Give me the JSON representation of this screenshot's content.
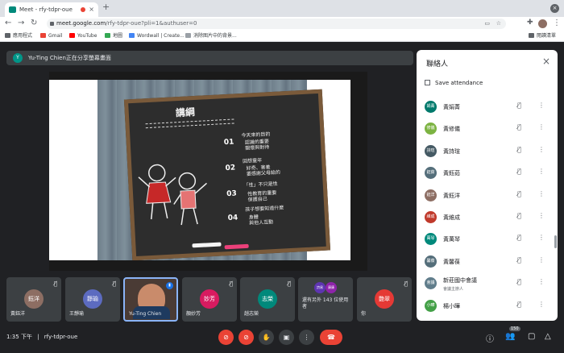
{
  "browser": {
    "tab_title": "Meet - rfy-tdpr-oue",
    "tab_close": "×",
    "new_tab": "+",
    "url_host": "meet.google.com",
    "url_path": "/rfy-tdpr-oue?pli=1&authuser=0",
    "bookmarks": [
      "應用程式",
      "Gmail",
      "YouTube",
      "地圖",
      "Wordwall | Create...",
      "消除图片中的背景..."
    ],
    "reading_list": "閱讀清單"
  },
  "banner": {
    "avatar": "Y",
    "text": "Yu-Ting Chien正在分享螢幕畫面"
  },
  "slide": {
    "title": "講綱",
    "sections": [
      {
        "num": "01",
        "heading": "今天來的目的",
        "bullets": [
          "認識的重要",
          "關懷與對待"
        ]
      },
      {
        "num": "02",
        "heading": "回想童年",
        "bullets": [
          "好奇、害羞",
          "要感謝父母給的"
        ]
      },
      {
        "num": "03",
        "heading": "「性」不只是性",
        "bullets": [
          "性教育的重要",
          "保護自己"
        ]
      },
      {
        "num": "04",
        "heading": "孩子想要知道什麼",
        "bullets": [
          "身體",
          "與他人互動"
        ]
      }
    ]
  },
  "panel": {
    "title": "聯絡人",
    "close": "×",
    "save_attendance": "Save attendance",
    "participants": [
      {
        "avatar": "娟菁",
        "name": "黃娟菁",
        "sub": "",
        "color": "#00796b"
      },
      {
        "avatar": "修儀",
        "name": "黃修儀",
        "sub": "",
        "color": "#7cb342"
      },
      {
        "avatar": "詩瑄",
        "name": "黃詩瑄",
        "sub": "",
        "color": "#455a64"
      },
      {
        "avatar": "鈺茹",
        "name": "黃鈺茹",
        "sub": "",
        "color": "#546e7a"
      },
      {
        "avatar": "鈺洋",
        "name": "黃鈺洋",
        "sub": "",
        "color": "#8d6e63"
      },
      {
        "avatar": "維成",
        "name": "黃維成",
        "sub": "",
        "color": "#c0392b"
      },
      {
        "avatar": "萬琴",
        "name": "黃萬琴",
        "sub": "",
        "color": "#00897b"
      },
      {
        "avatar": "馨葆",
        "name": "黃馨葆",
        "sub": "",
        "color": "#546e7a"
      },
      {
        "avatar": "會議",
        "name": "新莊國中會議",
        "sub": "會議主辦人",
        "color": "#607d8b"
      },
      {
        "avatar": "小曄",
        "name": "楊小曄",
        "sub": "",
        "color": "#43a047"
      }
    ]
  },
  "tiles": [
    {
      "avatar": "鈺洋",
      "name": "黃鈺洋",
      "color": "#8d6e63"
    },
    {
      "avatar": "靜瑜",
      "name": "王靜瑜",
      "color": "#5c6bc0"
    },
    {
      "avatar": "",
      "name": "Yu-Ting Chien",
      "color": "#1e88e5"
    },
    {
      "avatar": "妙芳",
      "name": "顏妙芳",
      "color": "#d81b60"
    },
    {
      "avatar": "志榮",
      "name": "趙志榮",
      "color": "#00897b"
    },
    {
      "avatar": "詩易",
      "name": "還有另外 143 位使用者",
      "color": "#5e35b1",
      "avatar2": "康康"
    },
    {
      "avatar": "艷翠",
      "name": "你",
      "color": "#e53935"
    }
  ],
  "bottom": {
    "time": "1:35 下午",
    "separator": "|",
    "meeting_code": "rfy-tdpr-oue",
    "participant_count": "150"
  }
}
